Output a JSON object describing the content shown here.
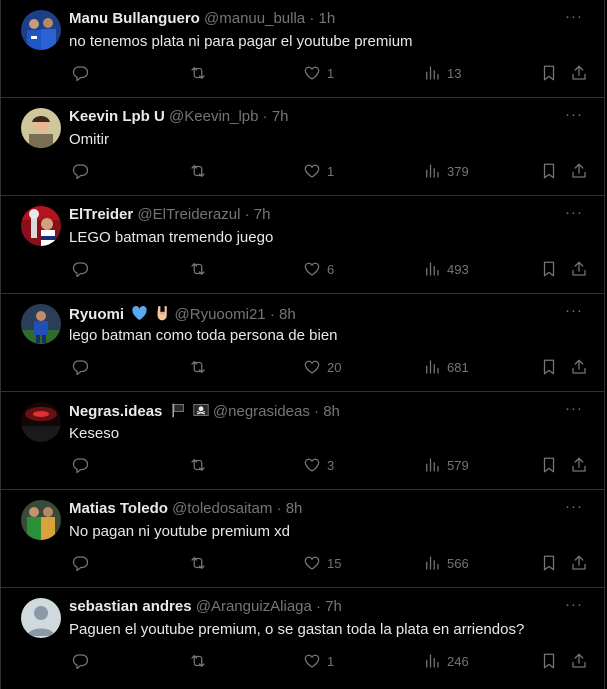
{
  "replies": [
    {
      "name": "Manu Bullanguero",
      "handle": "@manuu_bulla",
      "dot": "·",
      "time": "1h",
      "text": "no tenemos plata ni para pagar el youtube premium",
      "likes": "1",
      "views": "13",
      "avatar": "team"
    },
    {
      "name": "Keevin Lpb U",
      "handle": "@Keevin_lpb",
      "dot": "·",
      "time": "7h",
      "text": "Omitir",
      "likes": "1",
      "views": "379",
      "avatar": "person"
    },
    {
      "name": "ElTreider",
      "handle": "@ElTreiderazul",
      "dot": "·",
      "time": "7h",
      "text": "LEGO batman tremendo juego",
      "likes": "6",
      "views": "493",
      "avatar": "trophy"
    },
    {
      "name": "Ryuomi",
      "handle": "@Ryuoomi21",
      "dot": "·",
      "time": "8h",
      "text": "lego batman como toda persona de bien",
      "likes": "20",
      "views": "681",
      "avatar": "player",
      "badges": [
        "blue-heart-emoji",
        "rock-hand-emoji"
      ]
    },
    {
      "name": "Negras.ideas",
      "handle": "@negrasideas",
      "dot": "·",
      "time": "8h",
      "text": "Keseso",
      "likes": "3",
      "views": "579",
      "avatar": "dark",
      "badges": [
        "black-flag-emoji",
        "pirate-flag-emoji"
      ]
    },
    {
      "name": "Matias Toledo",
      "handle": "@toledosaitam",
      "dot": "·",
      "time": "8h",
      "text": "No pagan ni youtube premium xd",
      "likes": "15",
      "views": "566",
      "avatar": "goalkeeper"
    },
    {
      "name": "sebastian andres",
      "handle": "@AranguizAliaga",
      "dot": "·",
      "time": "7h",
      "text": "Paguen el youtube premium, o se  gastan toda la plata en arriendos?",
      "likes": "1",
      "views": "246",
      "avatar": "default"
    }
  ],
  "icons": {
    "reply": "reply-icon",
    "retweet": "retweet-icon",
    "like": "heart-icon",
    "views": "views-icon",
    "bookmark": "bookmark-icon",
    "share": "share-icon",
    "more": "more-icon"
  },
  "colors": {
    "background": "#000000",
    "border": "#2f3336",
    "text": "#e7e9ea",
    "muted": "#71767b"
  }
}
